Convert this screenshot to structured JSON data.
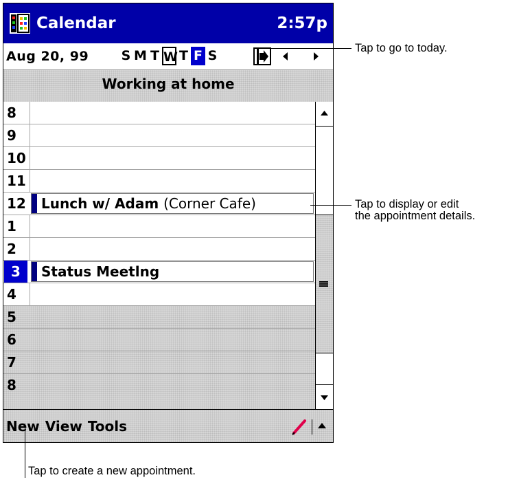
{
  "titlebar": {
    "app_name": "Calendar",
    "time": "2:57p",
    "icon": "calendar-app-icon"
  },
  "datebar": {
    "date": "Aug 20, 99",
    "weekdays": [
      "S",
      "M",
      "T",
      "W",
      "T",
      "F",
      "S"
    ],
    "today_index": 3,
    "selected_index": 5,
    "go_today_icon": "go-to-today-icon",
    "prev_icon": "left-arrow-icon",
    "next_icon": "right-arrow-icon"
  },
  "banner": "Working at home",
  "hours": [
    {
      "label": "8"
    },
    {
      "label": "9"
    },
    {
      "label": "10"
    },
    {
      "label": "11"
    },
    {
      "label": "12"
    },
    {
      "label": "1"
    },
    {
      "label": "2"
    },
    {
      "label": "3"
    },
    {
      "label": "4"
    },
    {
      "label": "5"
    },
    {
      "label": "6"
    },
    {
      "label": "7"
    },
    {
      "label": "8"
    }
  ],
  "appointments": [
    {
      "hour": "12",
      "title": "Lunch w/ Adam",
      "location": "(Corner Cafe)"
    },
    {
      "hour": "3",
      "title": "Status Meetlng",
      "location": ""
    }
  ],
  "command_bar": {
    "menu": [
      "New",
      "View",
      "Tools"
    ],
    "pen_icon": "pen-icon",
    "sip_icon": "input-panel-up-icon"
  },
  "callouts": {
    "today": "Tap to go to today.",
    "details_line1": "Tap to display or edit",
    "details_line2": "the appointment details.",
    "new": "Tap to create a new appointment."
  },
  "colors": {
    "title_bar": "#0000a8",
    "selection": "#0000cc",
    "appointment_marker": "#000080"
  }
}
